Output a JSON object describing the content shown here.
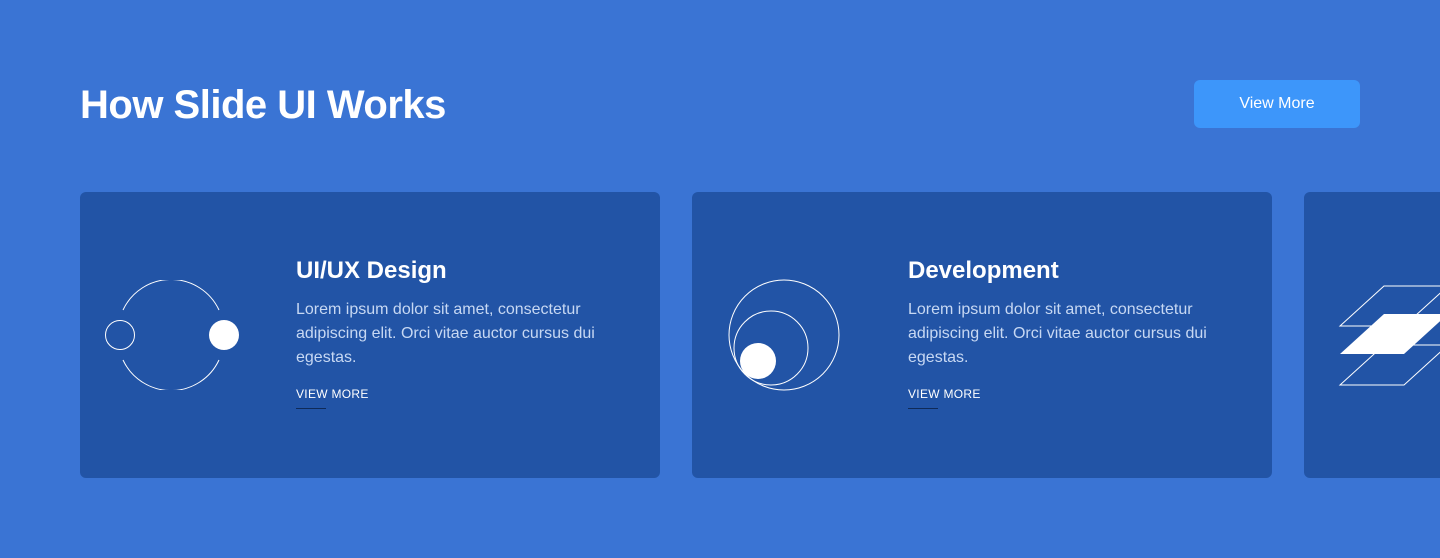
{
  "header": {
    "title": "How Slide UI Works",
    "button_label": "View More"
  },
  "cards": [
    {
      "icon": "circles-orbit-icon",
      "title": "UI/UX Design",
      "text": "Lorem ipsum dolor sit amet, consectetur adipiscing elit. Orci vitae auctor cursus dui egestas.",
      "link": "VIEW MORE"
    },
    {
      "icon": "nested-circles-icon",
      "title": "Development",
      "text": "Lorem ipsum dolor sit amet, consectetur adipiscing elit. Orci vitae auctor cursus dui egestas.",
      "link": "VIEW MORE"
    },
    {
      "icon": "layers-stack-icon"
    }
  ],
  "colors": {
    "background": "#3A74D4",
    "card": "#2254A6",
    "button": "#3D96FA",
    "body_text": "#C7D8F3",
    "link_underline": "#0F2A58"
  }
}
